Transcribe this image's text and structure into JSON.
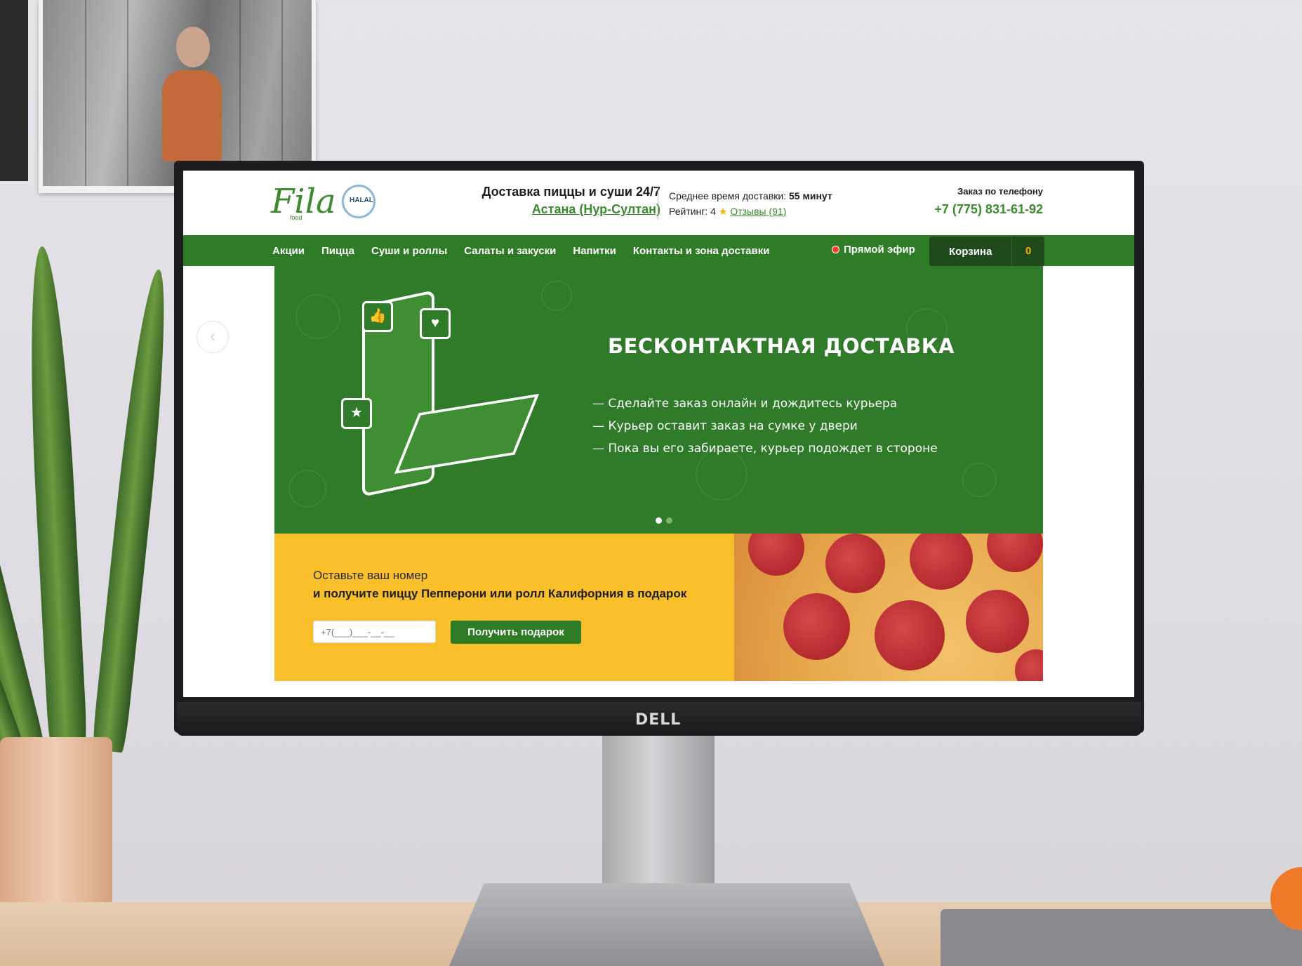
{
  "monitor": {
    "brand": "DELL"
  },
  "header": {
    "logo_text": "Fila",
    "logo_sub": "food",
    "halal_badge": "HALAL",
    "title": "Доставка пиццы и суши 24/7",
    "city": "Астана (Нур-Султан)",
    "delivery_label": "Среднее время доставки:",
    "delivery_value": "55 минут",
    "rating_label": "Рейтинг: 4",
    "reviews_link": "Отзывы (91)",
    "phone_label": "Заказ по телефону",
    "phone": "+7 (775) 831-61-92"
  },
  "nav": {
    "items": [
      {
        "label": "Акции"
      },
      {
        "label": "Пицца"
      },
      {
        "label": "Суши и роллы"
      },
      {
        "label": "Салаты и закуски"
      },
      {
        "label": "Напитки"
      },
      {
        "label": "Контакты и зона доставки"
      }
    ],
    "live_label": "Прямой эфир",
    "cart_label": "Корзина",
    "cart_count": "0"
  },
  "slider": {
    "title": "БЕСКОНТАКТНАЯ ДОСТАВКА",
    "lines": [
      "— Сделайте заказ онлайн и дождитесь курьера",
      "— Курьер оставит заказ на сумке у двери",
      "— Пока вы его забираете, курьер подождет в стороне"
    ],
    "prev_icon": "chevron-left-icon",
    "next_icon": "chevron-right-icon",
    "active_slide": 1,
    "slide_count": 2
  },
  "promo": {
    "line1": "Оставьте ваш номер",
    "line2": "и получите пиццу Пепперони или ролл Калифорния в подарок",
    "input_placeholder": "+7(___)___-__-__",
    "button_label": "Получить подарок"
  },
  "colors": {
    "brand_green": "#2e7d26",
    "dark_green": "#1f4a1b",
    "promo_yellow": "#f8bf2a",
    "accent_star": "#f5b400"
  }
}
